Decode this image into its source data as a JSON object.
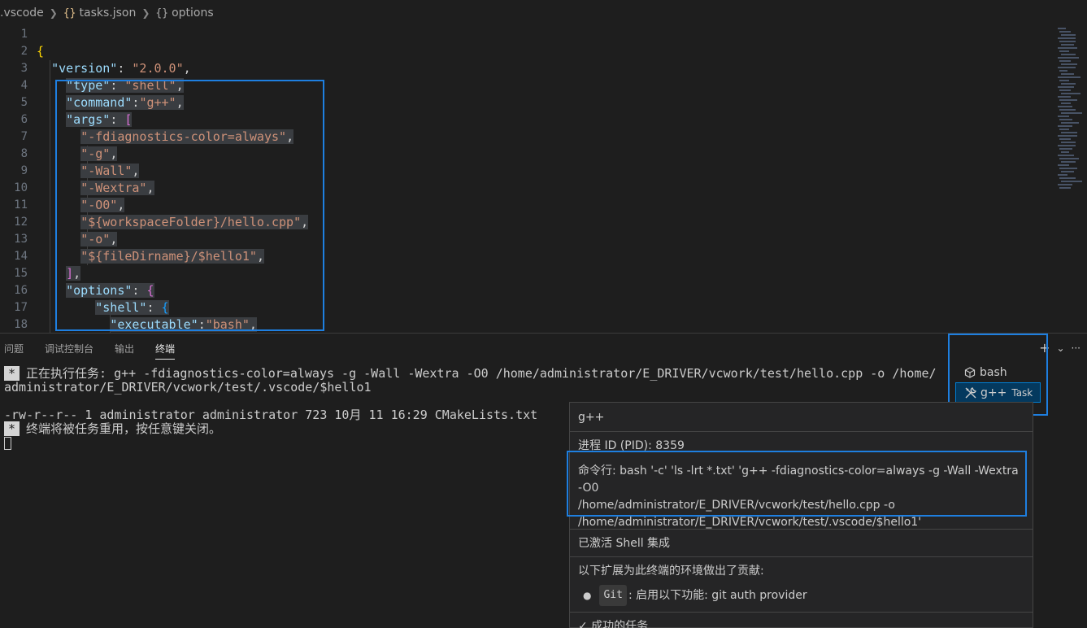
{
  "breadcrumb": {
    "root": ".vscode",
    "file_icon": "{}",
    "file": "tasks.json",
    "node_icon": "{}",
    "node": "options"
  },
  "editor": {
    "line_numbers": [
      "1",
      "2",
      "3",
      "4",
      "5",
      "6",
      "7",
      "8",
      "9",
      "10",
      "11",
      "12",
      "13",
      "14",
      "15",
      "16",
      "17",
      "18"
    ],
    "lines": {
      "l2_brace": "{",
      "version_key": "\"version\"",
      "version_val": "\"2.0.0\"",
      "type_key": "\"type\"",
      "type_val": "\"shell\"",
      "command_key": "\"command\"",
      "command_val": "\"g++\"",
      "args_key": "\"args\"",
      "args_open": "[",
      "arg1": "\"-fdiagnostics-color=always\"",
      "arg2": "\"-g\"",
      "arg3": "\"-Wall\"",
      "arg4": "\"-Wextra\"",
      "arg5": "\"-O0\"",
      "arg6": "\"${workspaceFolder}/hello.cpp\"",
      "arg7": "\"-o\"",
      "arg8": "\"${fileDirname}/$hello1\"",
      "args_close": "]",
      "options_key": "\"options\"",
      "options_open": "{",
      "shell_key": "\"shell\"",
      "shell_open": "{",
      "executable_key": "\"executable\"",
      "executable_val": "\"bash\""
    }
  },
  "panel": {
    "tabs": [
      "问题",
      "调试控制台",
      "输出",
      "终端"
    ],
    "active_tab": "终端",
    "actions": {
      "add": "+",
      "dropdown": "⌄",
      "more": "···"
    }
  },
  "terminal": {
    "badge": "*",
    "line1": "正在执行任务: g++ -fdiagnostics-color=always -g -Wall -Wextra -O0 /home/administrator/E_DRIVER/vcwork/test/hello.cpp -o /home/",
    "line2": "administrator/E_DRIVER/vcwork/test/.vscode/$hello1",
    "line3": "-rw-r--r-- 1 administrator administrator 723 10月 11 16:29 CMakeLists.txt",
    "line4": "终端将被任务重用，按任意键关闭。"
  },
  "terminal_list": [
    {
      "label": "bash",
      "icon": "terminal-bash-icon",
      "suffix": ""
    },
    {
      "label": "g++",
      "icon": "tools-icon",
      "suffix": "Task"
    }
  ],
  "hover": {
    "title": "g++",
    "pid": "进程 ID (PID): 8359",
    "cmd_line1": "命令行: bash '-c' 'ls -lrt *.txt' 'g++ -fdiagnostics-color=always -g -Wall -Wextra -O0",
    "cmd_line2": "/home/administrator/E_DRIVER/vcwork/test/hello.cpp -o",
    "cmd_line3": "/home/administrator/E_DRIVER/vcwork/test/.vscode/$hello1'",
    "shell_integration": "已激活 Shell 集成",
    "contrib_title": "以下扩展为此终端的环境做出了贡献:",
    "git_chip": "Git",
    "git_text": ": 启用以下功能: git auth provider",
    "success": "✓ 成功的任务"
  },
  "colors": {
    "highlight_box": "#1e7fe0",
    "selection": "#3a3d41",
    "key": "#9cdcfe",
    "string": "#ce9178"
  }
}
